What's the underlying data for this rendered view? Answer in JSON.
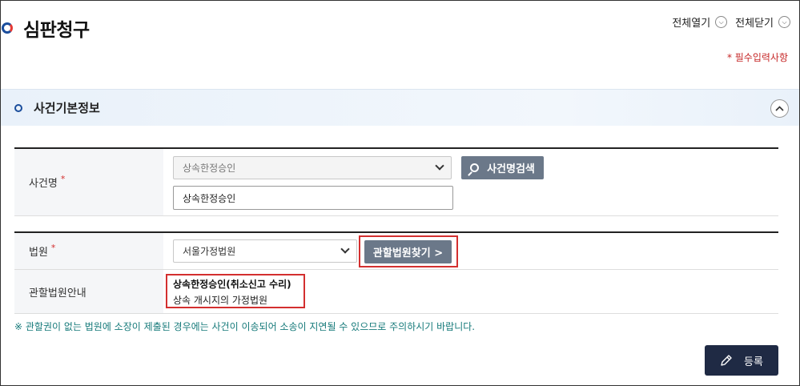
{
  "page": {
    "title": "심판청구",
    "expand_all_label": "전체열기",
    "collapse_all_label": "전체닫기",
    "required_note": "* 필수입력사항"
  },
  "section": {
    "title": "사건기본정보"
  },
  "case": {
    "label": "사건명",
    "required_mark": "*",
    "select_value": "상속한정승인",
    "input_value": "상속한정승인",
    "search_button": "사건명검색"
  },
  "court": {
    "label": "법원",
    "required_mark": "*",
    "select_value": "서울가정법원",
    "find_button": "관할법원찾기 >"
  },
  "jurisdiction": {
    "label": "관할법원안내",
    "line1": "상속한정승인(취소신고 수리)",
    "line2": "상속 개시지의 가정법원"
  },
  "notice": "※ 관할권이 없는 법원에 소장이 제출된 경우에는 사건이 이송되어 소송이 지연될 수 있으므로 주의하시기 바랍니다.",
  "submit_label": "등록",
  "colors": {
    "accent_blue": "#1a4d9c",
    "required_red": "#d32f2f",
    "notice_teal": "#167a7a",
    "submit_bg": "#1f2a44",
    "button_gray": "#6b7889"
  },
  "icons": [
    "title-ring-icon",
    "chevron-down-icon",
    "chevron-up-icon",
    "section-bullet-icon",
    "search-icon",
    "pencil-icon"
  ]
}
